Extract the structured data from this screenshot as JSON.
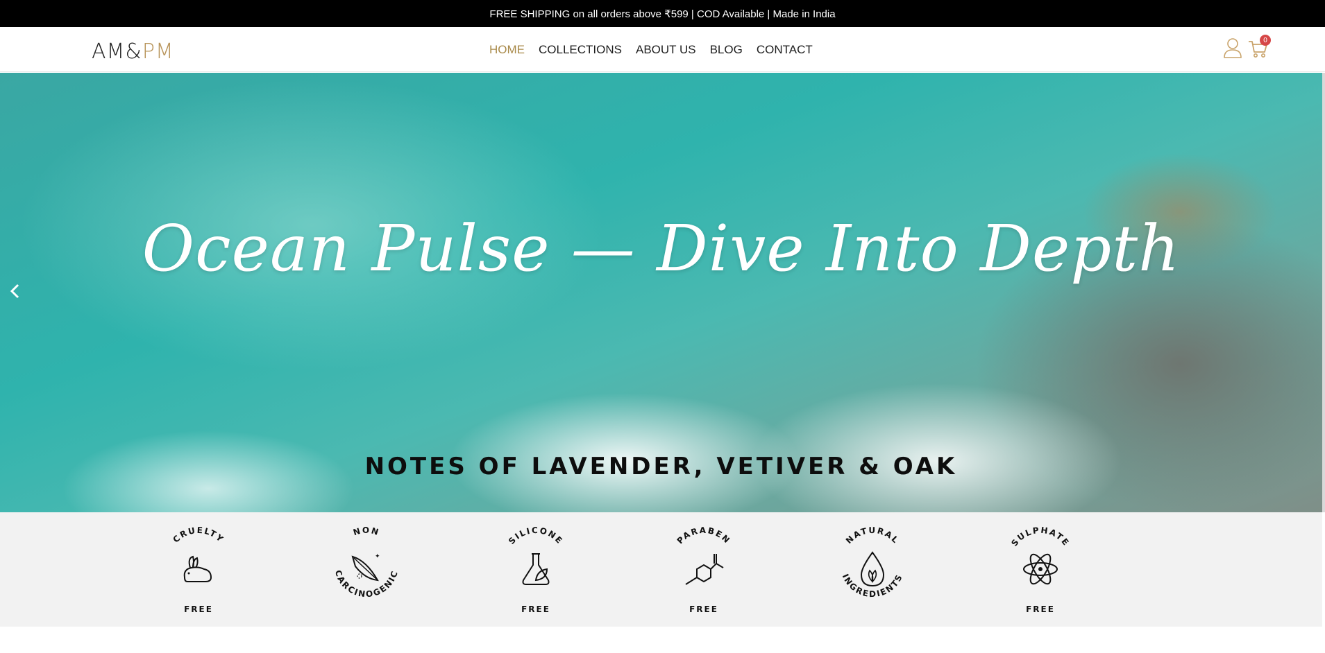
{
  "announcement": "FREE SHIPPING on all orders above ₹599 | COD Available | Made in India",
  "logo": {
    "am": "AM&",
    "pm": "PM"
  },
  "nav": {
    "items": [
      {
        "label": "HOME",
        "active": true
      },
      {
        "label": "COLLECTIONS",
        "active": false
      },
      {
        "label": "ABOUT US",
        "active": false
      },
      {
        "label": "BLOG",
        "active": false
      },
      {
        "label": "CONTACT",
        "active": false
      }
    ]
  },
  "header_icons": {
    "user": "user-icon",
    "cart": "cart-icon",
    "cart_count": "0"
  },
  "hero": {
    "title": "Ocean Pulse — Dive Into Depth",
    "subtitle": "NOTES OF LAVENDER, VETIVER & OAK",
    "prev_icon": "chevron-left-icon"
  },
  "features": [
    {
      "top": "CRUELTY",
      "bottom": "FREE",
      "icon": "rabbit-icon"
    },
    {
      "top": "NON",
      "bottom": "CARCINOGENIC",
      "icon": "feather-icon"
    },
    {
      "top": "SILICONE",
      "bottom": "FREE",
      "icon": "flask-leaf-icon"
    },
    {
      "top": "PARABEN",
      "bottom": "FREE",
      "icon": "molecule-icon"
    },
    {
      "top": "NATURAL",
      "bottom": "INGREDIENTS",
      "icon": "drop-leaf-icon"
    },
    {
      "top": "SULPHATE",
      "bottom": "FREE",
      "icon": "atom-icon"
    }
  ],
  "colors": {
    "accent": "#a98a4a",
    "badge": "#d64747",
    "topbar": "#000000",
    "features_bg": "#f2f2f2"
  }
}
